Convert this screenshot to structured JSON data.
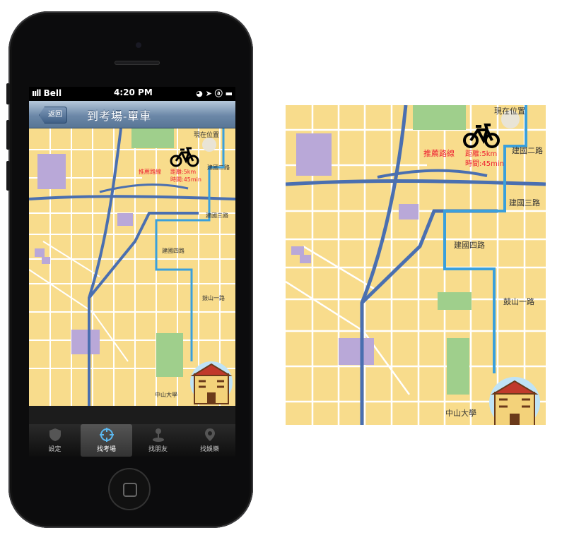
{
  "status_bar": {
    "carrier": "Bell",
    "time": "4:20 PM",
    "icons": "◕ ➤ ⓐ ▬"
  },
  "nav": {
    "back_label": "返回",
    "title": "到考場-單車"
  },
  "map": {
    "current_location_label": "現在位置",
    "recommended_route_label": "推薦路線",
    "distance_label": "距離:5km",
    "time_label": "時間:45min",
    "streets": {
      "jianguo_2": "建國二路",
      "jianguo_3": "建國三路",
      "jianguo_4": "建國四路",
      "gushan_1": "鼓山一路"
    },
    "destination_label": "中山大學",
    "route_color": "#3aa0dc",
    "road_color": "#4a6fb0",
    "land_color": "#f8dc8c",
    "park_color": "#9fcf8c",
    "building_color": "#b9a8d8"
  },
  "tabs": [
    {
      "label": "設定",
      "icon": "shield-icon"
    },
    {
      "label": "找考場",
      "icon": "target-icon"
    },
    {
      "label": "找朋友",
      "icon": "joystick-icon"
    },
    {
      "label": "找娛樂",
      "icon": "map-pin-icon"
    }
  ]
}
